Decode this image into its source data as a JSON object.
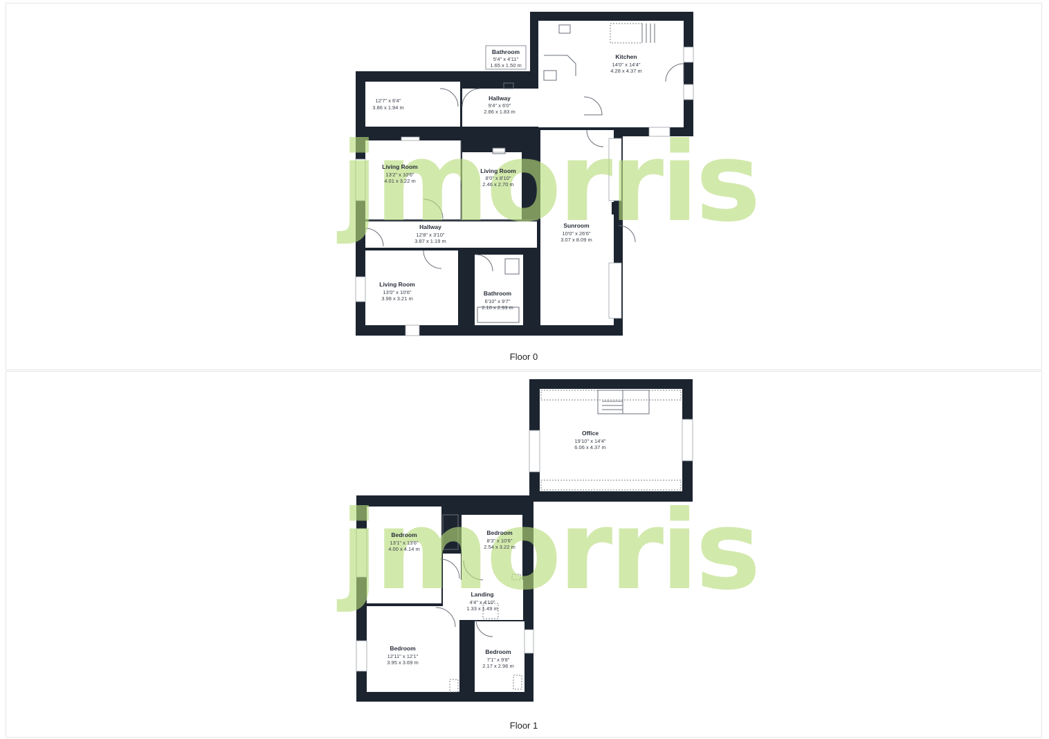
{
  "watermark": "jmorris",
  "floors": [
    {
      "label": "Floor 0",
      "rooms": [
        {
          "id": "bathroom-small",
          "name": "Bathroom",
          "imperial": "5'4\" x 4'11\"",
          "metric": "1.65 x 1.50 m"
        },
        {
          "id": "kitchen",
          "name": "Kitchen",
          "imperial": "14'0\" x 14'4\"",
          "metric": "4.28 x 4.37 m"
        },
        {
          "id": "store",
          "name": "",
          "imperial": "12'7\" x 6'4\"",
          "metric": "3.86 x 1.94 m"
        },
        {
          "id": "hallway-upper",
          "name": "Hallway",
          "imperial": "9'4\" x 6'0\"",
          "metric": "2.86 x 1.83 m"
        },
        {
          "id": "living-room-1",
          "name": "Living Room",
          "imperial": "13'2\" x 10'6\"",
          "metric": "4.01 x 3.22 m"
        },
        {
          "id": "living-room-2",
          "name": "Living Room",
          "imperial": "8'0\" x 8'10\"",
          "metric": "2.46 x 2.70 m"
        },
        {
          "id": "sunroom",
          "name": "Sunroom",
          "imperial": "10'0\" x 26'6\"",
          "metric": "3.07 x 8.09 m"
        },
        {
          "id": "hallway-lower",
          "name": "Hallway",
          "imperial": "12'8\" x 3'10\"",
          "metric": "3.87 x 1.19 m"
        },
        {
          "id": "living-room-3",
          "name": "Living Room",
          "imperial": "13'0\" x 10'6\"",
          "metric": "3.98 x 3.21 m"
        },
        {
          "id": "bathroom-large",
          "name": "Bathroom",
          "imperial": "6'10\" x 9'7\"",
          "metric": "2.10 x 2.93 m"
        }
      ]
    },
    {
      "label": "Floor 1",
      "rooms": [
        {
          "id": "office",
          "name": "Office",
          "imperial": "19'10\" x 14'4\"",
          "metric": "6.06 x 4.37 m"
        },
        {
          "id": "bedroom-1",
          "name": "Bedroom",
          "imperial": "13'1\" x 13'6\"",
          "metric": "4.00 x 4.14 m"
        },
        {
          "id": "bedroom-2",
          "name": "Bedroom",
          "imperial": "8'3\" x 10'6\"",
          "metric": "2.54 x 3.22 m"
        },
        {
          "id": "landing",
          "name": "Landing",
          "imperial": "4'4\" x 4'10\"",
          "metric": "1.33 x 1.49 m"
        },
        {
          "id": "bedroom-3",
          "name": "Bedroom",
          "imperial": "12'11\" x 12'1\"",
          "metric": "3.95 x 3.69 m"
        },
        {
          "id": "bedroom-4",
          "name": "Bedroom",
          "imperial": "7'1\" x 9'8\"",
          "metric": "2.17 x 2.96 m"
        }
      ]
    }
  ]
}
